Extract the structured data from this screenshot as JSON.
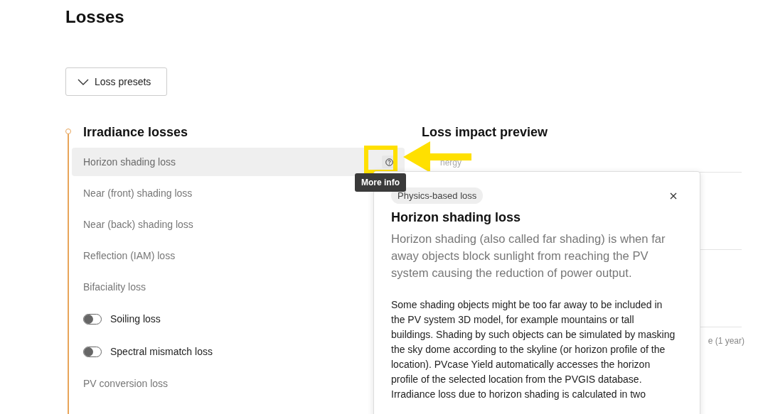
{
  "page": {
    "title": "Losses"
  },
  "presets_button": {
    "label": "Loss presets"
  },
  "section": {
    "title": "Irradiance losses",
    "items": [
      {
        "label": "Horizon shading loss",
        "kind": "plain",
        "selected": true
      },
      {
        "label": "Near (front) shading loss",
        "kind": "plain",
        "selected": false
      },
      {
        "label": "Near (back) shading loss",
        "kind": "plain",
        "selected": false
      },
      {
        "label": "Reflection (IAM) loss",
        "kind": "plain",
        "selected": false
      },
      {
        "label": "Bifaciality loss",
        "kind": "plain",
        "selected": false
      },
      {
        "label": "Soiling loss",
        "kind": "toggle",
        "on": false,
        "selected": false
      },
      {
        "label": "Spectral mismatch loss",
        "kind": "toggle",
        "on": false,
        "selected": false
      },
      {
        "label": "PV conversion loss",
        "kind": "plain",
        "selected": false
      }
    ]
  },
  "preview": {
    "title": "Loss impact preview",
    "fragments": [
      "nergy",
      "e (1 year)"
    ]
  },
  "tooltip": {
    "text": "More info"
  },
  "popover": {
    "tag": "Physics-based loss",
    "title": "Horizon shading loss",
    "lead": "Horizon shading (also called far shading) is when far away objects block sunlight from reaching the PV system causing the reduction of power output.",
    "body": [
      "Some shading objects might be too far away to be included in the PV system 3D model, for example mountains or tall buildings. Shading by such objects can be simulated by masking the sky dome according to the skyline (or horizon profile of the location). PVcase Yield automatically accesses the horizon profile of the selected location from the PVGIS database.",
      "Irradiance loss due to horizon shading is calculated in two"
    ]
  }
}
